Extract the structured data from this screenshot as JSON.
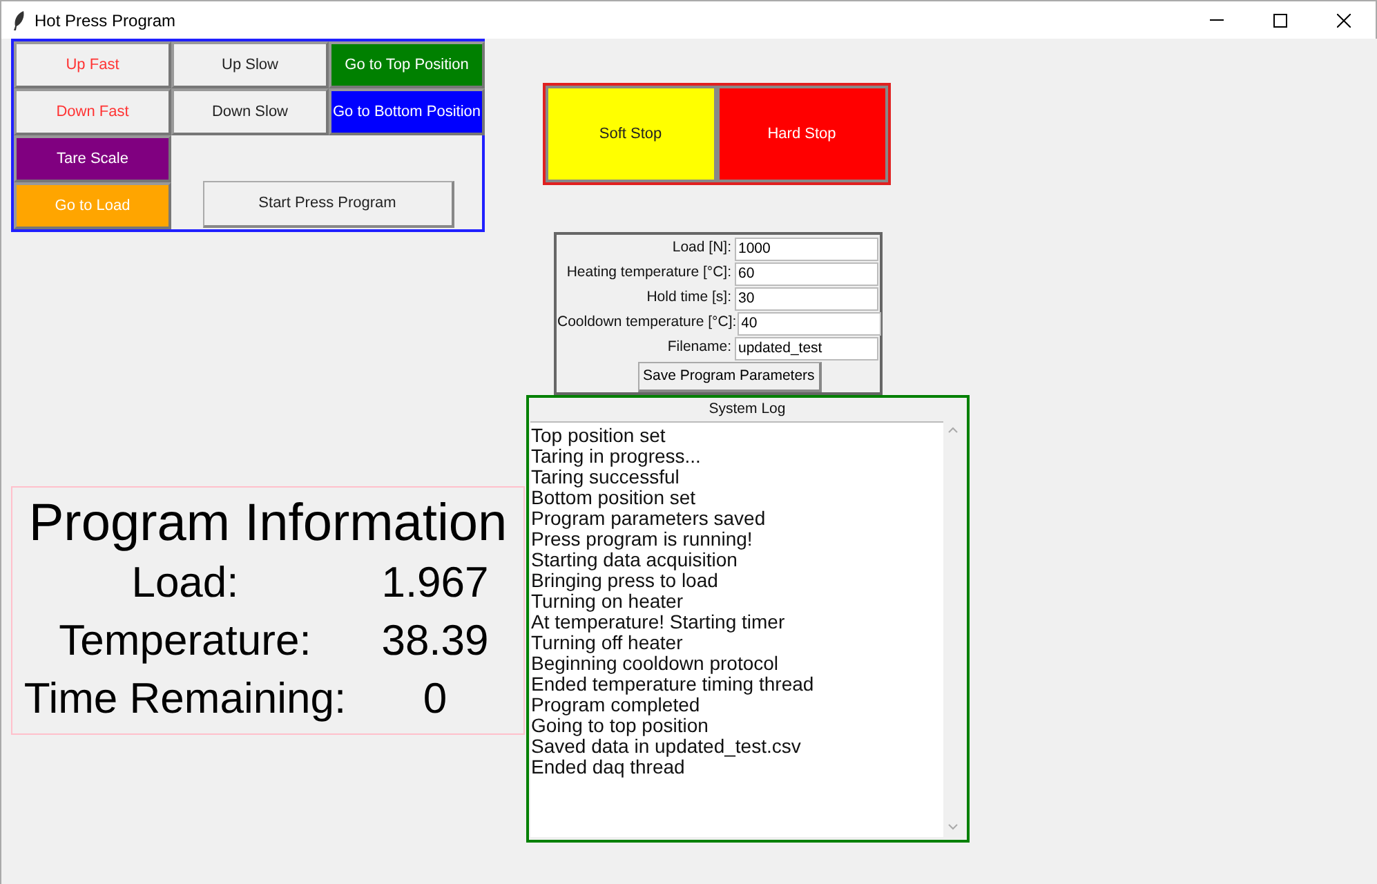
{
  "window": {
    "title": "Hot Press Program"
  },
  "controls": [
    {
      "label": "Up Fast",
      "color": "#f0f0f0",
      "kind": "fast"
    },
    {
      "label": "Up Slow",
      "color": "#f0f0f0",
      "kind": "plain"
    },
    {
      "label": "Go to Top Position",
      "color": "#008000",
      "kind": "inverse"
    },
    {
      "label": "Down Fast",
      "color": "#f0f0f0",
      "kind": "fast"
    },
    {
      "label": "Down Slow",
      "color": "#f0f0f0",
      "kind": "plain"
    },
    {
      "label": "Go to Bottom Position",
      "color": "#0000ff",
      "kind": "inverse"
    },
    {
      "label": "Tare Scale",
      "color": "#800080",
      "kind": "inverse"
    },
    {
      "label": "Go to Load",
      "color": "#ffa500",
      "kind": "inverse"
    }
  ],
  "start_button": "Start Press Program",
  "stops": [
    {
      "label": "Soft Stop",
      "color": "#ffff00",
      "kind": "plain"
    },
    {
      "label": "Hard Stop",
      "color": "#ff0000",
      "kind": "inverse"
    }
  ],
  "parameters": [
    {
      "label": "Load [N]:",
      "value": "1000"
    },
    {
      "label": "Heating temperature [°C]:",
      "value": "60"
    },
    {
      "label": "Hold time [s]:",
      "value": "30"
    },
    {
      "label": "Cooldown temperature [°C]:",
      "value": "40"
    },
    {
      "label": "Filename:",
      "value": "updated_test"
    }
  ],
  "save_button": "Save Program Parameters",
  "system_log": {
    "title": "System Log",
    "lines": [
      "Top position set",
      "Taring in progress...",
      "Taring successful",
      "Bottom position set",
      "Program parameters saved",
      "Press program is running!",
      "Starting data acquisition",
      "Bringing press to load",
      "Turning on heater",
      "At temperature! Starting timer",
      "Turning off heater",
      "Beginning cooldown protocol",
      "Ended temperature timing thread",
      "Program completed",
      "Going to top position",
      "Saved data in updated_test.csv",
      "Ended daq thread"
    ]
  },
  "program_information": {
    "title": "Program Information",
    "rows": [
      {
        "label": "Load:",
        "value": "1.967"
      },
      {
        "label": "Temperature:",
        "value": "38.39"
      },
      {
        "label": "Time Remaining:",
        "value": "0"
      }
    ]
  }
}
